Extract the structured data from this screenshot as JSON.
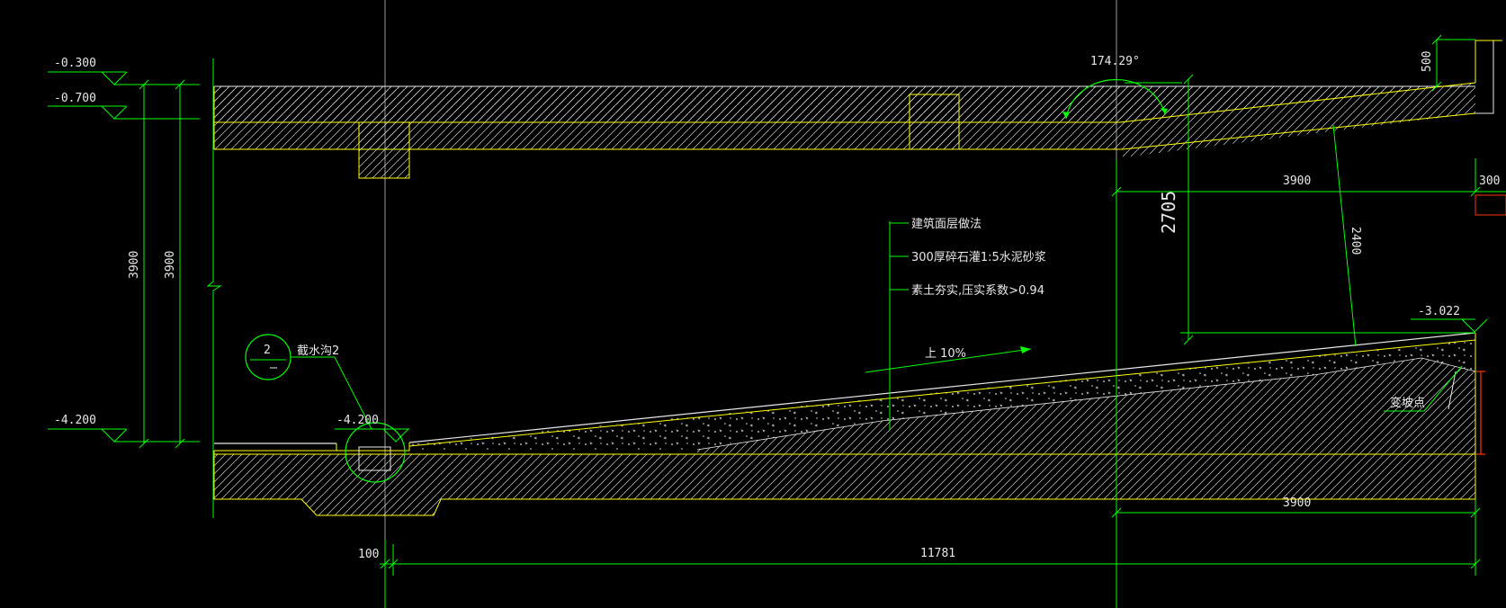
{
  "colors": {
    "background": "#000000",
    "dimension": "#00ff00",
    "outline": "#ffff00",
    "hatch": "#d8d8d8",
    "grid": "#9a9a9a",
    "text": "#e8e8e8",
    "marker": "#ff3300"
  },
  "levels": {
    "top": "-0.300",
    "second": "-0.700",
    "bottom": "-4.200",
    "trench": "-4.200",
    "ramp_top": "-3.022"
  },
  "dimensions": {
    "height_outer": "3900",
    "height_inner": "3900",
    "angle": "174.29°",
    "parapet": "500",
    "clear_height": "2705",
    "top_run": "3900",
    "top_end": "300",
    "slope_thickness": "2400",
    "bottom_run": "3900",
    "length_small": "100",
    "length_total": "11781"
  },
  "callout": {
    "number": "2",
    "label": "截水沟2"
  },
  "layers": [
    "建筑面层做法",
    "300厚碎石灌1:5水泥砂浆",
    "素土夯实,压实系数>0.94"
  ],
  "slope_label": "上 10%",
  "break_point": "变坡点"
}
